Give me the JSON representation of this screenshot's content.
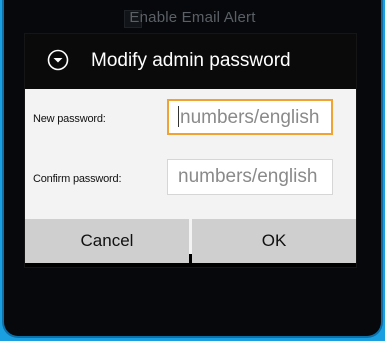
{
  "background": {
    "setting_label": "Enable Email Alert"
  },
  "dialog": {
    "title": "Modify admin password",
    "header_icon": "chevron-down-circle-icon",
    "fields": {
      "new_password": {
        "label": "New password:",
        "placeholder": "numbers/english",
        "value": "",
        "focused": true
      },
      "confirm_password": {
        "label": "Confirm password:",
        "placeholder": "numbers/english",
        "value": ""
      }
    },
    "buttons": {
      "cancel": "Cancel",
      "ok": "OK"
    }
  },
  "colors": {
    "outer_border": "#1aa0e0",
    "focus_border": "#f0a232",
    "button_bg": "#cfcfcf"
  }
}
